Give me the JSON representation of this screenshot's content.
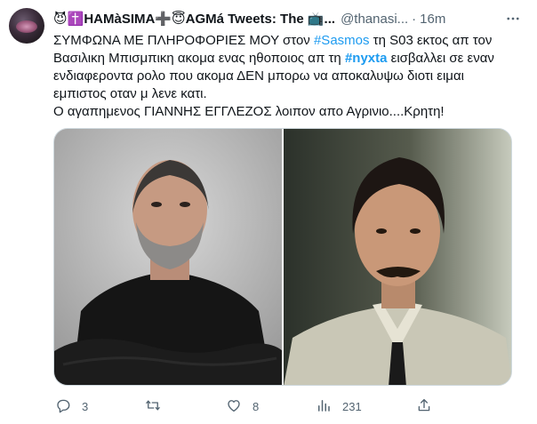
{
  "author": {
    "display_name": "😈✝️HΑΜàSIΜΑ➕😇ΑGΜá Tweets: The 📺...",
    "handle": "@thanasi...",
    "separator": "·",
    "time": "16m"
  },
  "text": {
    "l1_a": "ΣΥΜΦΩΝΑ ΜΕ ΠΛΗΡΟΦΟΡΙΕΣ ΜΟΥ στον ",
    "l1_tag": "#Sasmos",
    "l1_b": " τη S03 εκτος απ τον",
    "l2_a": "Βασιλικη Μπισμπικη ακομα ενας ηθοποιος απ τη ",
    "l2_tag": "#nyxta",
    "l2_b": " εισβαλλει σε εναν",
    "l3": "ενδιαφεροντα ρολο που ακομα ΔΕΝ μπορω να αποκαλυψω διοτι ειμαι",
    "l4": "εμπιστος οταν μ λενε κατι.",
    "l5": "Ο αγαπημενος ΓΙΑΝΝΗΣ ΕΓΓΛΕΖΟΣ λοιπον απο Αγρινιο....Κρητη!"
  },
  "actions": {
    "replies": "3",
    "retweets": "",
    "likes": "8",
    "views": "231"
  },
  "icons": {
    "more": "more-dots-icon",
    "reply": "reply-icon",
    "retweet": "retweet-icon",
    "like": "heart-icon",
    "views": "views-icon",
    "share": "share-icon"
  },
  "colors": {
    "link": "#1d9bf0",
    "muted": "#536471",
    "text": "#0f1419"
  }
}
